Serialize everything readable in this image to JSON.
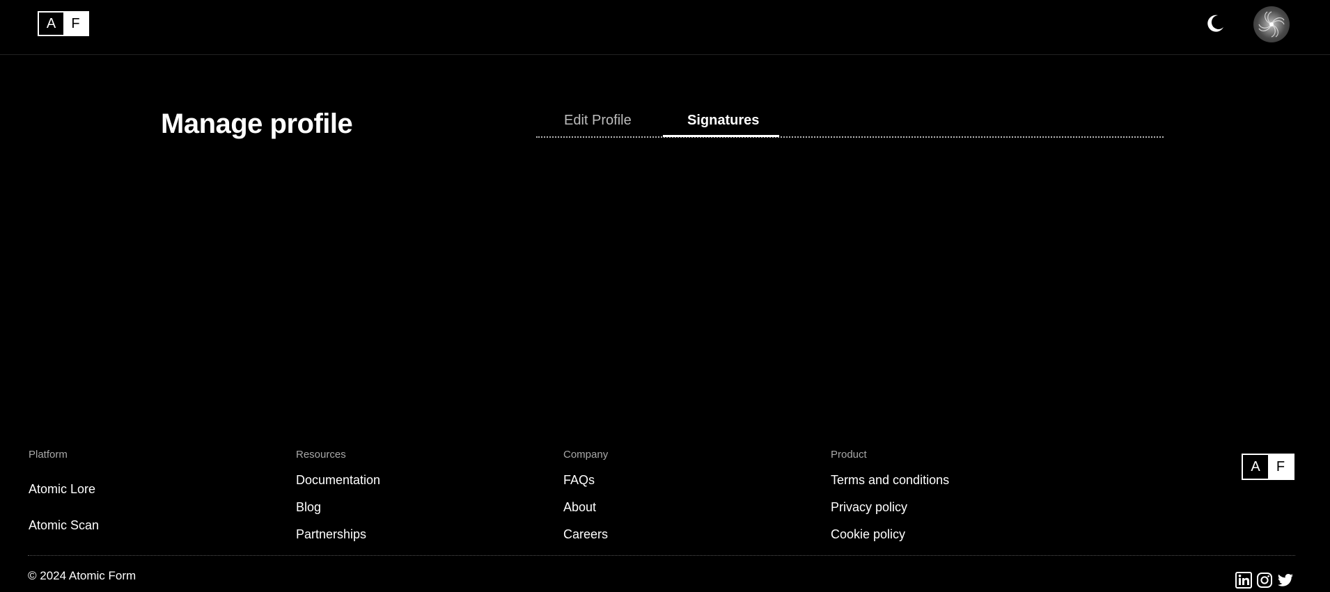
{
  "header": {
    "logo": {
      "left": "A",
      "right": "F"
    },
    "theme_toggle_icon": "moon-icon",
    "avatar_icon": "avatar"
  },
  "main": {
    "title": "Manage profile",
    "tabs": [
      {
        "label": "Edit Profile",
        "active": false
      },
      {
        "label": "Signatures",
        "active": true
      }
    ]
  },
  "footer": {
    "columns": [
      {
        "heading": "Platform",
        "links": [
          "Atomic Lore",
          "Atomic Scan"
        ]
      },
      {
        "heading": "Resources",
        "links": [
          "Documentation",
          "Blog",
          "Partnerships"
        ]
      },
      {
        "heading": "Company",
        "links": [
          "FAQs",
          "About",
          "Careers"
        ]
      },
      {
        "heading": "Product",
        "links": [
          "Terms and conditions",
          "Privacy policy",
          "Cookie policy"
        ]
      }
    ],
    "logo": {
      "left": "A",
      "right": "F"
    },
    "copyright": "© 2024 Atomic Form",
    "social_icons": [
      "linkedin-icon",
      "instagram-icon",
      "twitter-icon"
    ]
  },
  "colors": {
    "background": "#000000",
    "text": "#ffffff",
    "muted": "#a8a8a8"
  }
}
